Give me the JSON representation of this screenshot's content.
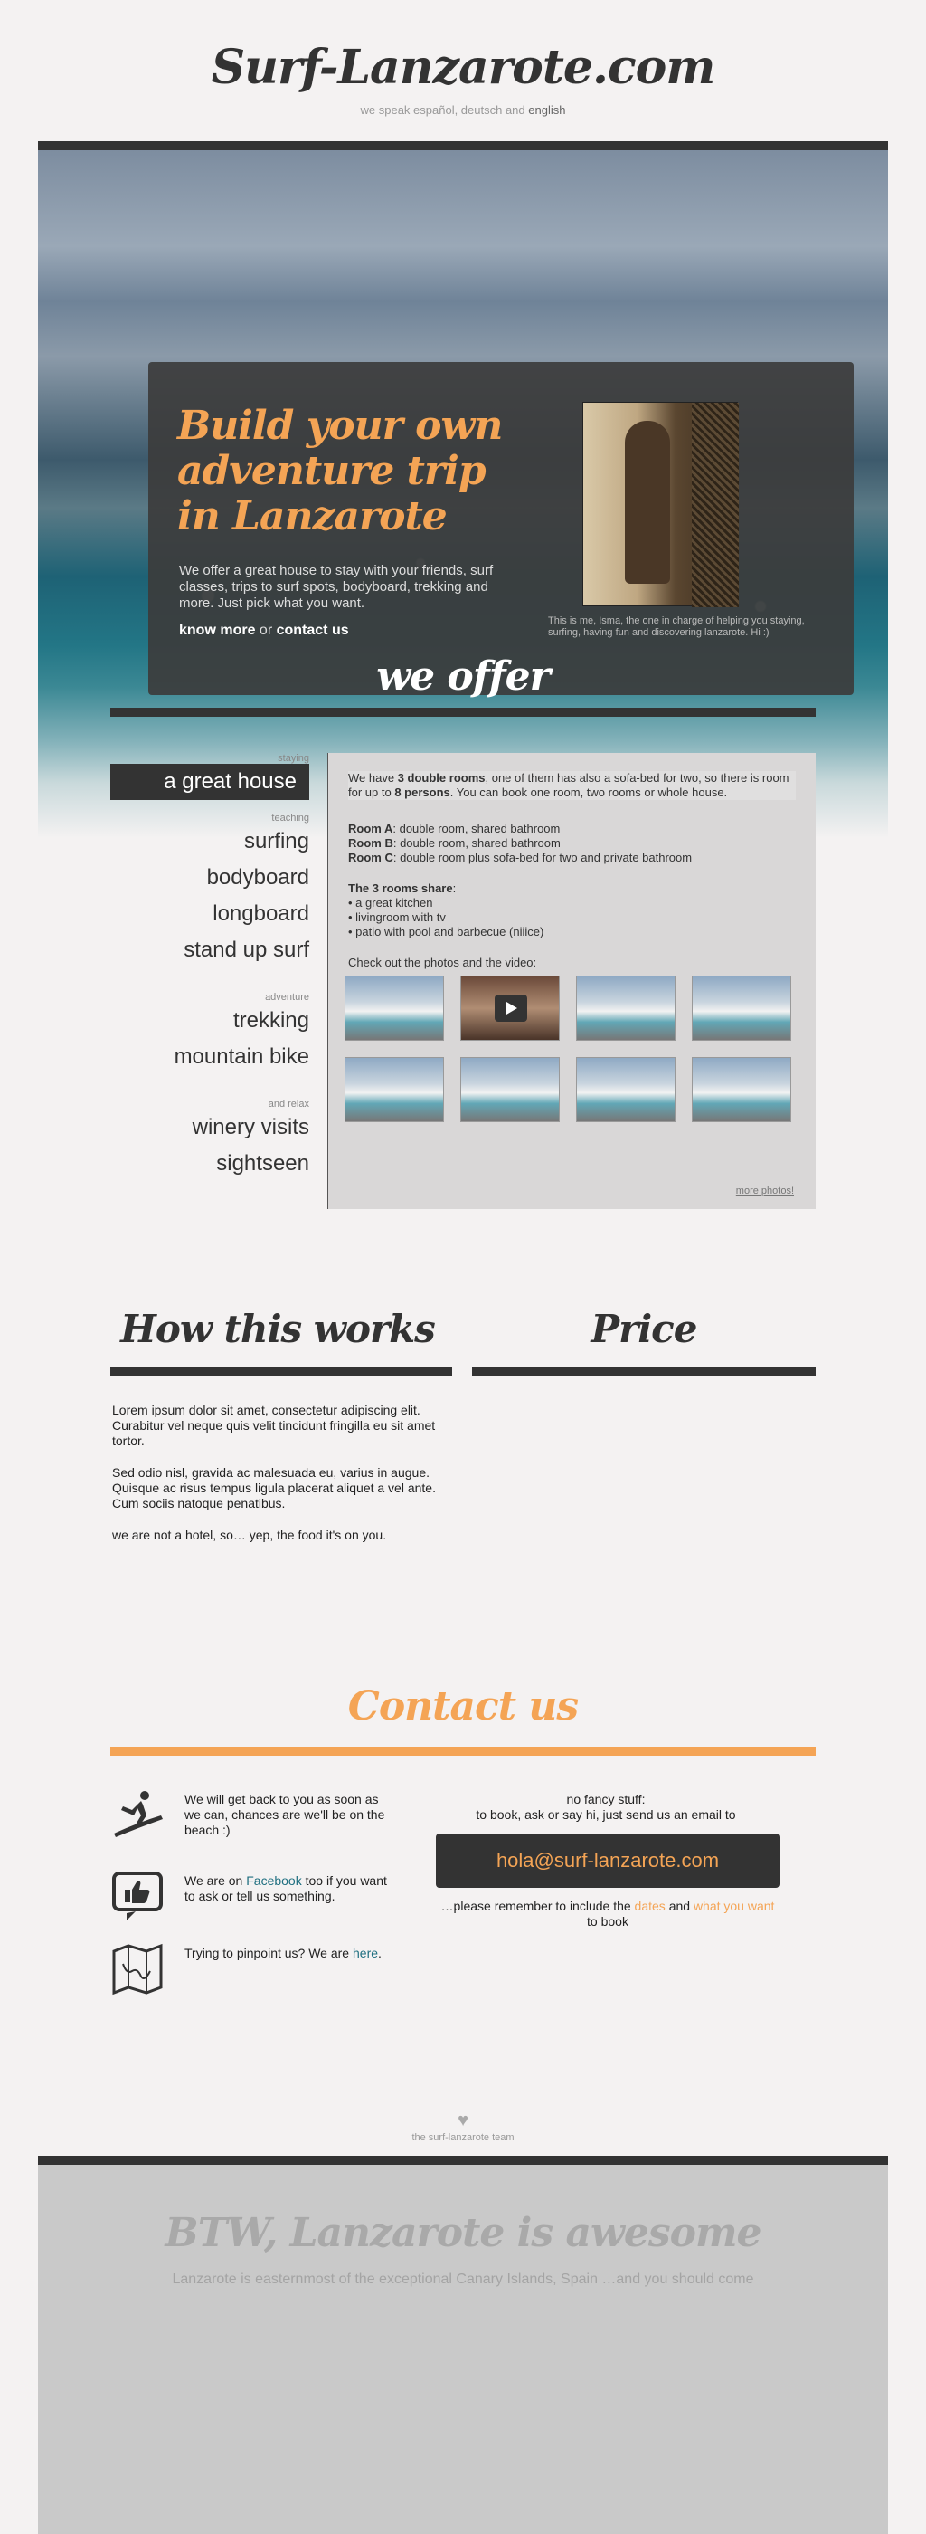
{
  "header": {
    "site_title": "Surf-Lanzarote.com",
    "lang_prefix": "we speak español, deutsch and",
    "lang_active": "english"
  },
  "hero": {
    "heading": "Build your own adventure trip in Lanzarote",
    "text": "We offer a great house to stay with your friends, surf classes, trips to surf spots, bodyboard, trekking and more. Just pick what you want.",
    "link_know_more": "know more",
    "link_or": "or",
    "link_contact": "contact us",
    "caption": "This is me, Isma, the one in charge of helping you staying, surfing, having fun and discovering lanzarote. Hi :)"
  },
  "offer": {
    "title": "we offer",
    "groups": [
      {
        "label": "staying",
        "items": [
          "a great house"
        ]
      },
      {
        "label": "teaching",
        "items": [
          "surfing",
          "bodyboard",
          "longboard",
          "stand up surf"
        ]
      },
      {
        "label": "adventure",
        "items": [
          "trekking",
          "mountain bike"
        ]
      },
      {
        "label": "and relax",
        "items": [
          "winery visits",
          "sightseen"
        ]
      }
    ],
    "panel": {
      "intro_a": "We have",
      "intro_b": "3 double rooms",
      "intro_c": ", one of them has also a sofa-bed for two, so there is room for up to",
      "intro_d": "8 persons",
      "intro_e": ". You can book one room, two rooms or whole house.",
      "rooms": [
        {
          "name": "Room A",
          "desc": ": double room, shared bathroom"
        },
        {
          "name": "Room B",
          "desc": ": double room, shared bathroom"
        },
        {
          "name": "Room C",
          "desc": ": double room plus sofa-bed for two and private bathroom"
        }
      ],
      "share_title": "The 3 rooms share",
      "share_items": [
        "• a great kitchen",
        "• livingroom with tv",
        "• patio with pool and barbecue (niiice)"
      ],
      "photos_label": "Check out the photos and the video:",
      "more_photos": "more photos!"
    }
  },
  "how": {
    "title": "How this works",
    "paragraphs": [
      "Lorem ipsum dolor sit amet, consectetur adipiscing elit. Curabitur vel neque quis velit tincidunt fringilla eu sit amet tortor.",
      "Sed odio nisl, gravida ac malesuada eu, varius in augue. Quisque ac risus tempus ligula placerat aliquet a vel ante. Cum sociis natoque penatibus.",
      "we are not a hotel, so… yep, the food it's on you."
    ]
  },
  "price": {
    "title": "Price"
  },
  "contact": {
    "title": "Contact us",
    "row1": "We will get back to you as soon as we can, chances are we'll be on the beach :)",
    "row2_a": "We are on",
    "row2_link": "Facebook",
    "row2_b": "too if you want to ask or tell us something.",
    "row3_a": "Trying to pinpoint us? We are",
    "row3_link": "here",
    "row3_b": ".",
    "fancy_1": "no fancy stuff:",
    "fancy_2": "to book, ask or say hi, just send us an email to",
    "email": "hola@surf-lanzarote.com",
    "remember_a": "…please remember to include the",
    "remember_dates": "dates",
    "remember_and": "and",
    "remember_want": "what you want",
    "remember_b": "to book"
  },
  "footer": {
    "heart": "♥",
    "team": "the surf-lanzarote team",
    "btw_title": "BTW, Lanzarote is awesome",
    "btw_sub": "Lanzarote is easternmost of the exceptional Canary Islands, Spain …and you should come"
  },
  "colors": {
    "accent": "#f4a455",
    "dark": "#333333",
    "link": "#1f6f80"
  }
}
